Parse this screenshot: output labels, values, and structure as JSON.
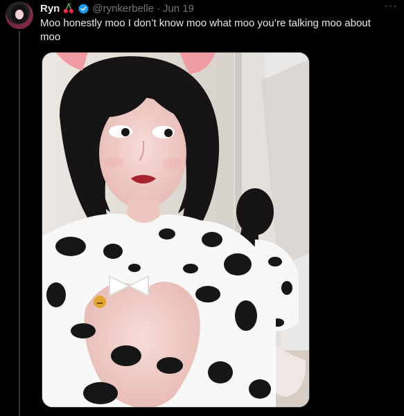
{
  "tweet": {
    "author": {
      "display_name": "Ryn",
      "handle": "@rynkerbelle",
      "emoji": "cherry-icon",
      "verified": true
    },
    "separator": "·",
    "date": "Jun 19",
    "text": "Moo honestly moo I don’t know moo what moo you’re talking moo about moo",
    "more_icon": "more-icon",
    "media": {
      "kind": "photo",
      "icon": "photo-placeholder"
    }
  },
  "colors": {
    "background": "#000000",
    "text_primary": "#e7e9ea",
    "text_secondary": "#71767b",
    "verified_blue": "#1d9bf0",
    "thread_line": "#333639"
  }
}
